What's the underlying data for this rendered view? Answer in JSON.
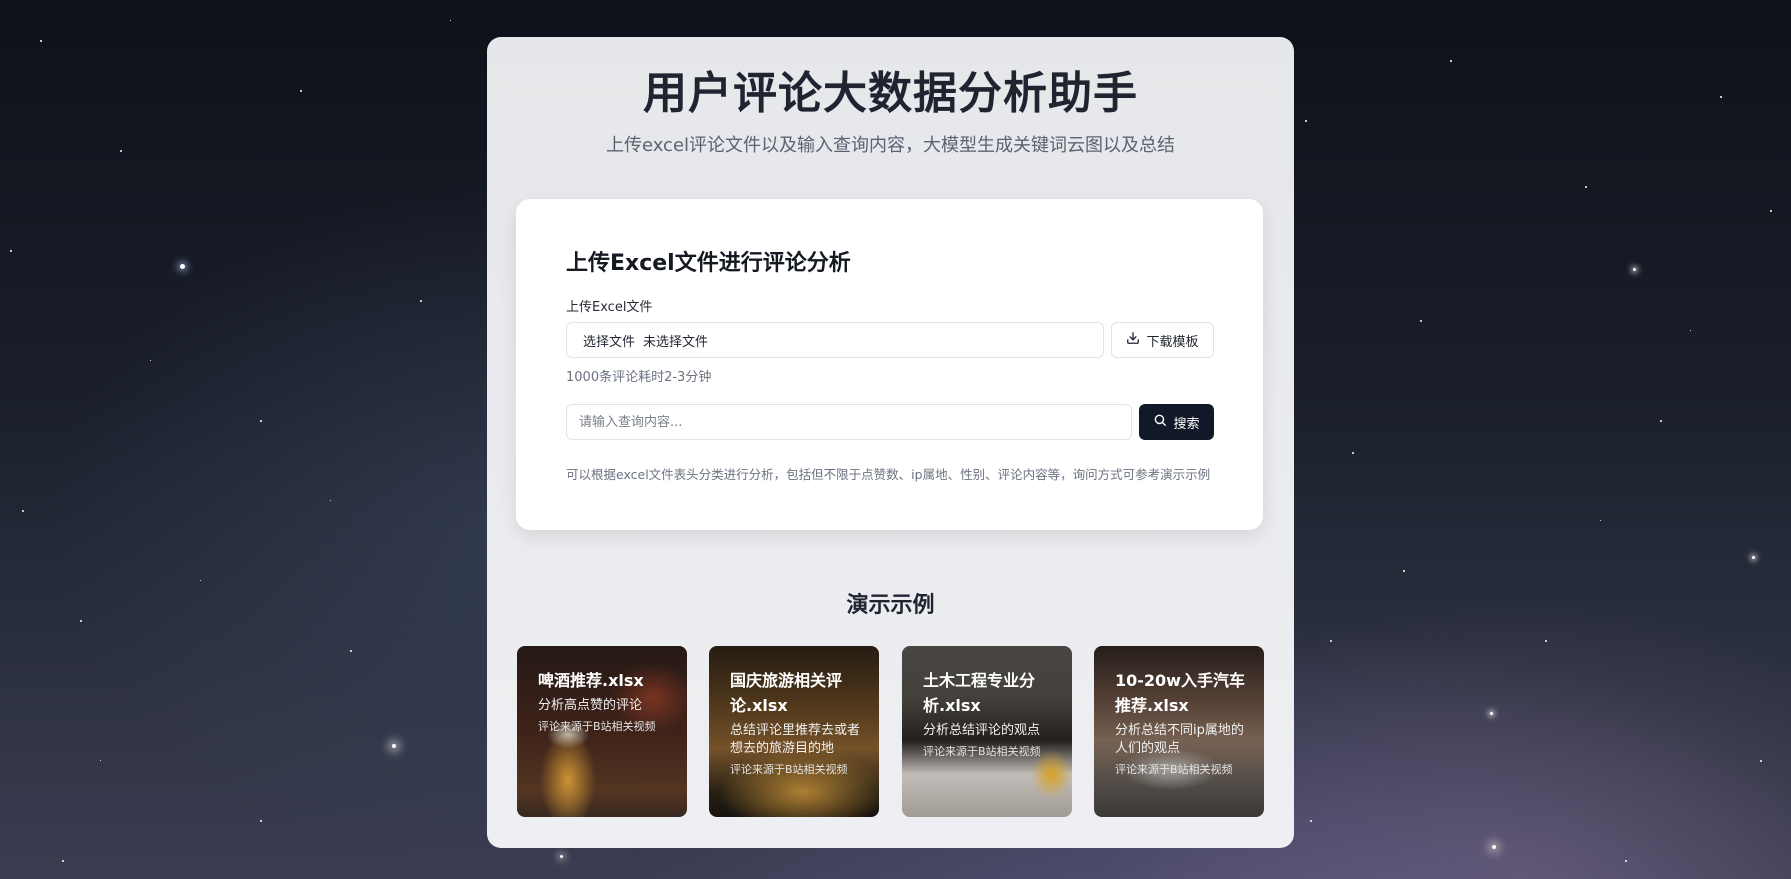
{
  "header": {
    "title": "用户评论大数据分析助手",
    "subtitle": "上传excel评论文件以及输入查询内容，大模型生成关键词云图以及总结"
  },
  "upload": {
    "title": "上传Excel文件进行评论分析",
    "file_label": "上传Excel文件",
    "choose_file": "选择文件",
    "no_file": "未选择文件",
    "download_label": "下载模板",
    "time_hint": "1000条评论耗时2-3分钟",
    "search_placeholder": "请输入查询内容...",
    "search_label": "搜索",
    "usage_hint": "可以根据excel文件表头分类进行分析，包括但不限于点赞数、ip属地、性别、评论内容等，询问方式可参考演示示例"
  },
  "demo": {
    "title": "演示示例",
    "items": [
      {
        "title": "啤酒推荐.xlsx",
        "desc": "分析高点赞的评论",
        "source": "评论来源于B站相关视频"
      },
      {
        "title": "国庆旅游相关评论.xlsx",
        "desc": "总结评论里推荐去或者想去的旅游目的地",
        "source": "评论来源于B站相关视频"
      },
      {
        "title": "土木工程专业分析.xlsx",
        "desc": "分析总结评论的观点",
        "source": "评论来源于B站相关视频"
      },
      {
        "title": "10-20w入手汽车推荐.xlsx",
        "desc": "分析总结不同ip属地的人们的观点",
        "source": "评论来源于B站相关视频"
      }
    ]
  },
  "icons": {
    "download": "download-icon",
    "search": "search-icon"
  },
  "colors": {
    "primary_button": "#111827",
    "panel_background": "#eceef1",
    "card_background": "#ffffff",
    "title_text": "#1f2430"
  }
}
